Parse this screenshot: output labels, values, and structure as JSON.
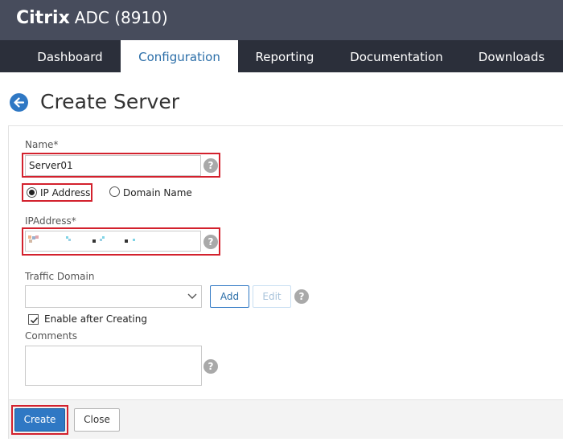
{
  "app": {
    "brand_bold": "Citrix",
    "brand_rest": "ADC (8910)"
  },
  "nav": {
    "tabs": [
      {
        "label": "Dashboard",
        "active": false
      },
      {
        "label": "Configuration",
        "active": true
      },
      {
        "label": "Reporting",
        "active": false
      },
      {
        "label": "Documentation",
        "active": false
      },
      {
        "label": "Downloads",
        "active": false
      }
    ]
  },
  "page": {
    "title": "Create Server"
  },
  "form": {
    "name_label": "Name*",
    "name_value": "Server01",
    "address_type": {
      "options": [
        "IP Address",
        "Domain Name"
      ],
      "selected": "IP Address"
    },
    "ip_label": "IPAddress*",
    "traffic_domain_label": "Traffic Domain",
    "traffic_domain_value": "",
    "add_label": "Add",
    "edit_label": "Edit",
    "enable_after_creating_label": "Enable after Creating",
    "enable_after_creating_checked": true,
    "comments_label": "Comments",
    "comments_value": "",
    "help_glyph": "?"
  },
  "actions": {
    "create_label": "Create",
    "close_label": "Close"
  },
  "colors": {
    "header_bg": "#474c5c",
    "nav_bg": "#2b2f3a",
    "accent": "#2f78c4",
    "highlight_box": "#d3212d"
  },
  "icons": {
    "back": "arrow-left-circle-icon",
    "help": "question-circle-icon",
    "dropdown": "chevron-down-icon",
    "check": "checkmark-icon"
  }
}
